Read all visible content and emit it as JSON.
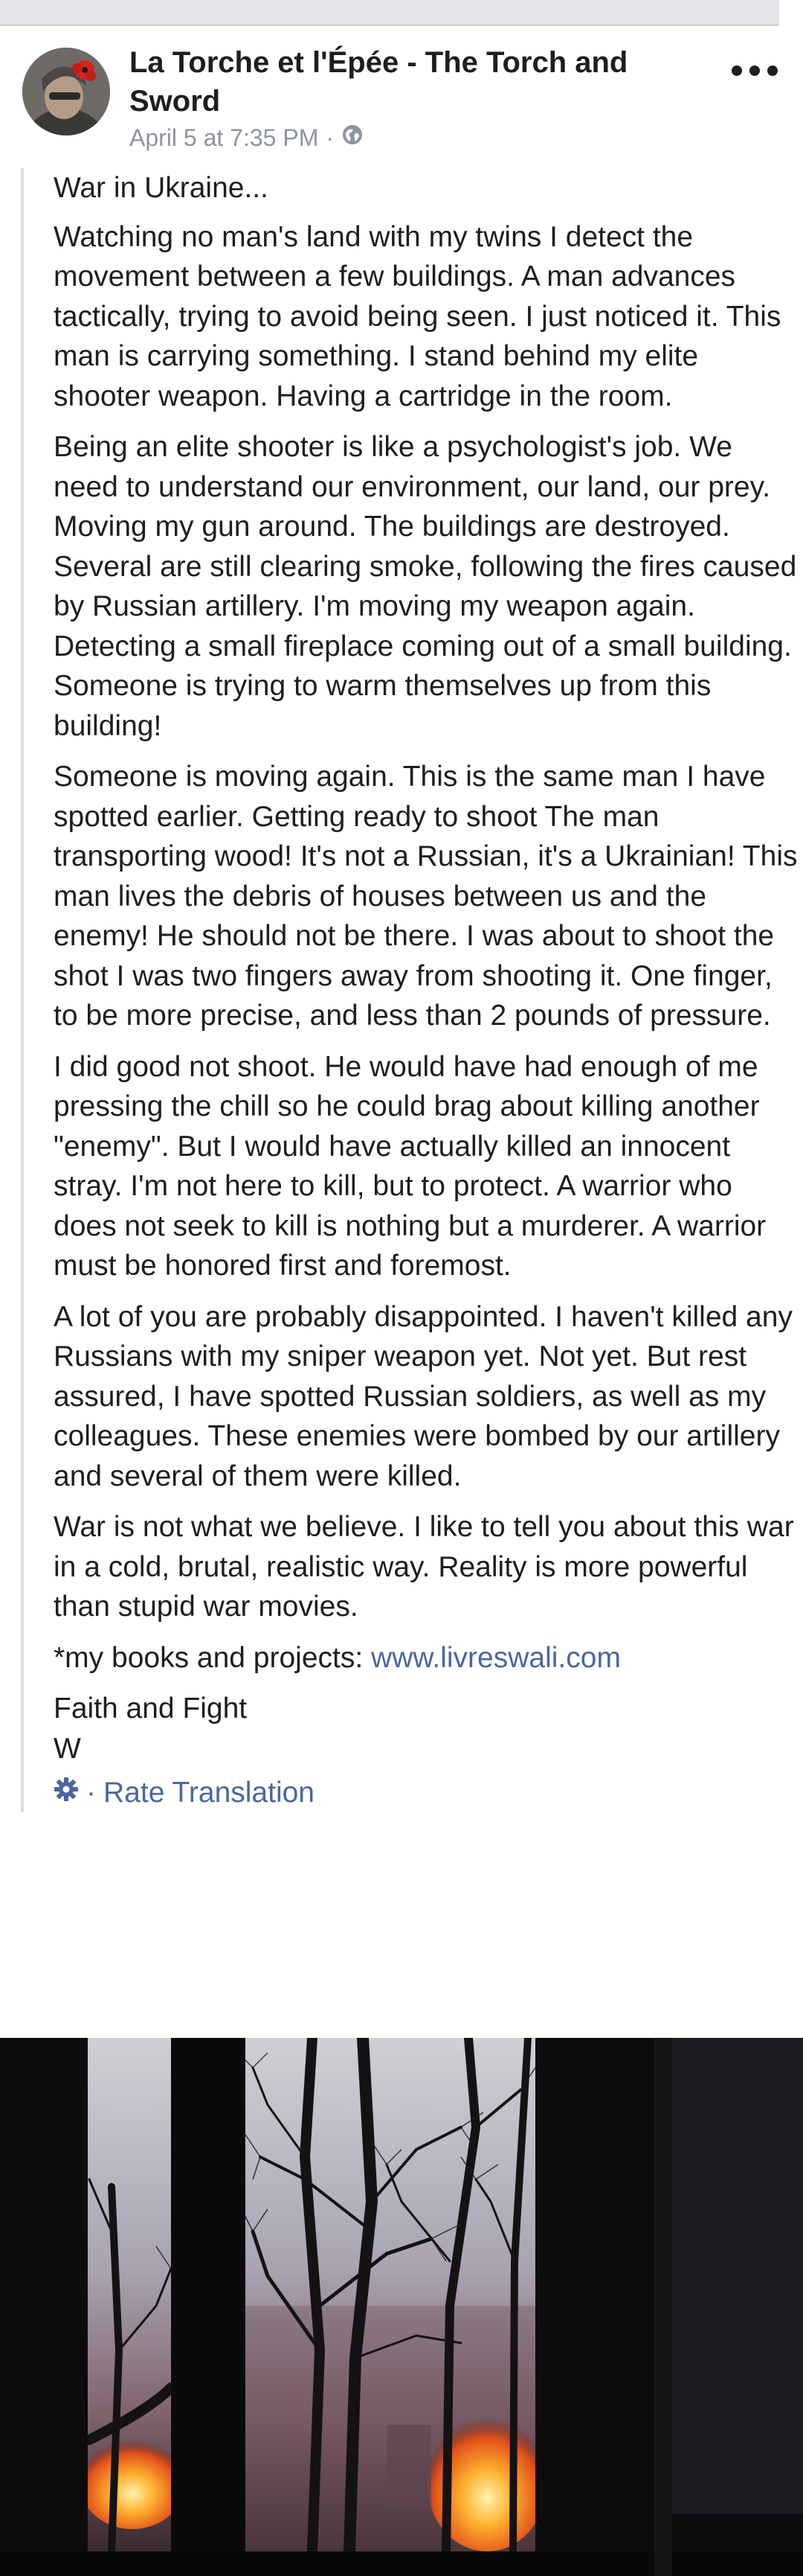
{
  "post": {
    "author": "La Torche et l'Épée - The Torch and Sword",
    "timestamp": "April 5 at 7:35 PM",
    "separator": "·",
    "paragraphs": [
      "War in Ukraine...",
      "Watching no man's land with my twins I detect the movement between a few buildings. A man advances tactically, trying to avoid being seen. I just noticed it. This man is carrying something. I stand behind my elite shooter weapon. Having a cartridge in the room.",
      "Being an elite shooter is like a psychologist's job. We need to understand our environment, our land, our prey. Moving my gun around. The buildings are destroyed. Several are still clearing smoke, following the fires caused by Russian artillery. I'm moving my weapon again. Detecting a small fireplace coming out of a small building. Someone is trying to warm themselves up from this building!",
      "Someone is moving again. This is the same man I have spotted earlier. Getting ready to shoot The man transporting wood! It's not a Russian, it's a Ukrainian! This man lives the debris of houses between us and the enemy! He should not be there. I was about to shoot the shot I was two fingers away from shooting it. One finger, to be more precise, and less than 2 pounds of pressure.",
      "I did good not shoot. He would have had enough of me pressing the chill so he could brag about killing another \"enemy\". But I would have actually killed an innocent stray. I'm not here to kill, but to protect. A warrior who does not seek to kill is nothing but a murderer. A warrior must be honored first and foremost.",
      "A lot of you are probably disappointed. I haven't killed any Russians with my sniper weapon yet. Not yet. But rest assured, I have spotted Russian soldiers, as well as my colleagues. These enemies were bombed by our artillery and several of them were killed.",
      "War is not what we believe. I like to tell you about this war in a cold, brutal, realistic way. Reality is more powerful than stupid war movies."
    ],
    "books_prefix": "*my books and projects: ",
    "books_link": "www.livreswali.com",
    "signoff_line1": "Faith and Fight",
    "signoff_line2": "W",
    "rate_separator": "·",
    "rate_translation": "Rate Translation"
  },
  "icons": {
    "audience": "globe-icon",
    "menu": "more-dots-icon",
    "settings": "gear-icon"
  },
  "colors": {
    "link": "#4b67a1",
    "meta": "#8d949e",
    "text": "#1c1e21",
    "quote_bar": "#dadde1"
  }
}
